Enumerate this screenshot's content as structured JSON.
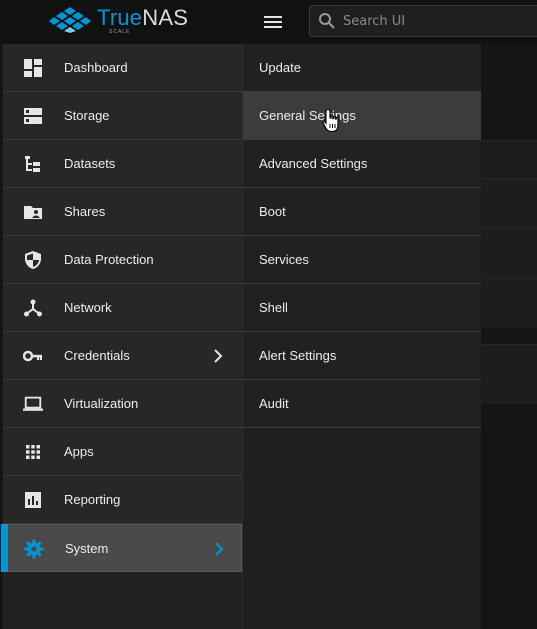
{
  "header": {
    "logo_true": "True",
    "logo_nas": "NAS",
    "logo_sub": "SCALE",
    "search_placeholder": "Search UI"
  },
  "sidebar": {
    "items": [
      {
        "label": "Dashboard",
        "icon": "dashboard-icon"
      },
      {
        "label": "Storage",
        "icon": "storage-icon"
      },
      {
        "label": "Datasets",
        "icon": "datasets-icon"
      },
      {
        "label": "Shares",
        "icon": "shares-folder-icon"
      },
      {
        "label": "Data Protection",
        "icon": "shield-icon"
      },
      {
        "label": "Network",
        "icon": "network-icon"
      },
      {
        "label": "Credentials",
        "icon": "key-icon",
        "has_submenu": true
      },
      {
        "label": "Virtualization",
        "icon": "laptop-icon"
      },
      {
        "label": "Apps",
        "icon": "apps-grid-icon"
      },
      {
        "label": "Reporting",
        "icon": "reporting-icon"
      },
      {
        "label": "System",
        "icon": "gear-icon",
        "has_submenu": true,
        "active": true
      }
    ]
  },
  "submenu": {
    "parent": "System",
    "hovered": "General Settings",
    "items": [
      {
        "label": "Update"
      },
      {
        "label": "General Settings"
      },
      {
        "label": "Advanced Settings"
      },
      {
        "label": "Boot"
      },
      {
        "label": "Services"
      },
      {
        "label": "Shell"
      },
      {
        "label": "Alert Settings"
      },
      {
        "label": "Audit"
      }
    ]
  },
  "colors": {
    "accent": "#0095d5",
    "topbar": "#111111",
    "sidebar": "#272727",
    "active_item": "#4a4a4a",
    "text": "#ededed"
  }
}
